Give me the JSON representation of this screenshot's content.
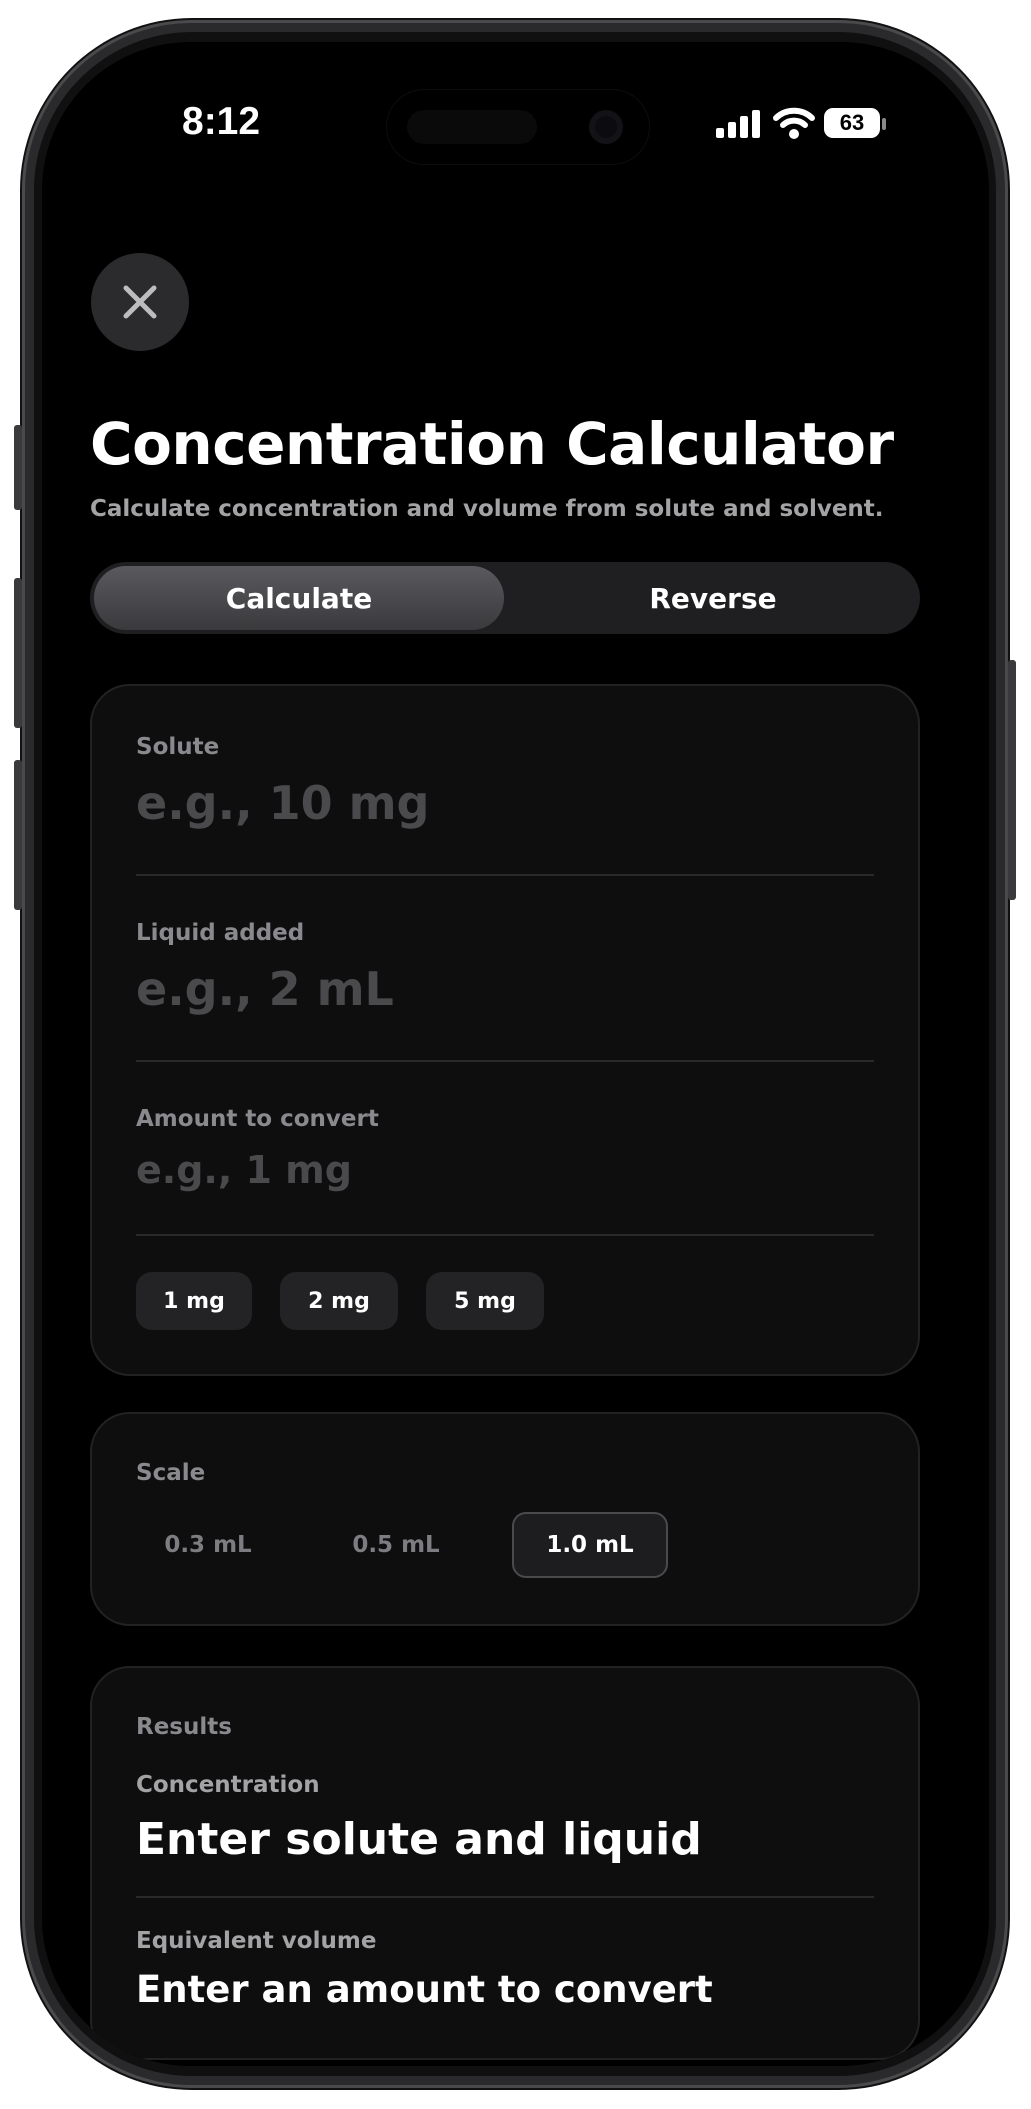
{
  "status_bar": {
    "time": "8:12",
    "battery": "63"
  },
  "header": {
    "title": "Concentration Calculator",
    "subtitle": "Calculate concentration and volume from solute and solvent."
  },
  "mode_tabs": [
    {
      "label": "Calculate",
      "selected": true
    },
    {
      "label": "Reverse",
      "selected": false
    }
  ],
  "inputs": {
    "solute": {
      "label": "Solute",
      "placeholder": "e.g., 10 mg",
      "value": ""
    },
    "liquid": {
      "label": "Liquid added",
      "placeholder": "e.g., 2 mL",
      "value": ""
    },
    "amount": {
      "label": "Amount to convert",
      "placeholder": "e.g., 1 mg",
      "value": ""
    }
  },
  "quick_amounts": [
    "1 mg",
    "2 mg",
    "5 mg"
  ],
  "scale": {
    "label": "Scale",
    "options": [
      "0.3 mL",
      "0.5 mL",
      "1.0 mL"
    ],
    "selected": "1.0 mL"
  },
  "results": {
    "heading": "Results",
    "concentration_label": "Concentration",
    "concentration_value": "Enter solute and liquid",
    "volume_label": "Equivalent volume",
    "volume_value": "Enter an amount to convert"
  },
  "colors": {
    "background": "#000000",
    "card": "#0e0e0f",
    "accent": "#ffffff",
    "muted": "#8a8a8e"
  },
  "icons": [
    "close-icon",
    "cellular-signal-icon",
    "wifi-icon",
    "battery-icon"
  ]
}
